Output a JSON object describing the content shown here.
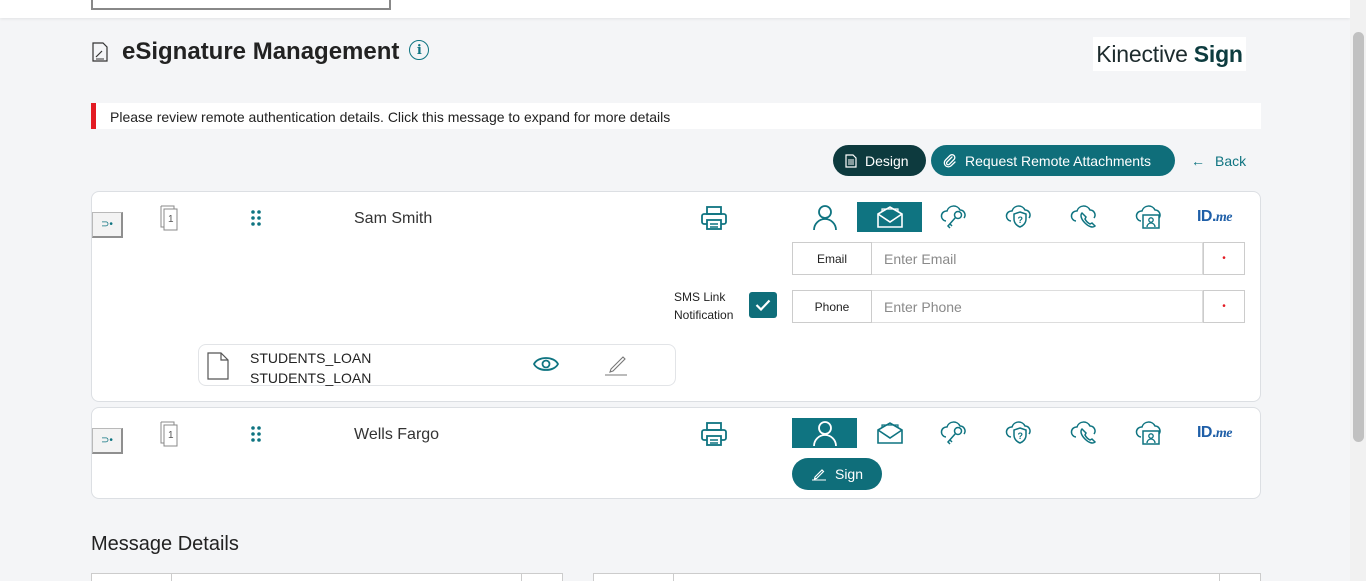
{
  "header": {
    "title": "eSignature Management",
    "brand_prefix": "Kinective",
    "brand_suffix": "Sign"
  },
  "alert": {
    "message": "Please review remote authentication details. Click this message to expand for more details"
  },
  "actions": {
    "design_label": "Design",
    "remote_label": "Request Remote Attachments",
    "back_label": "Back"
  },
  "signers": [
    {
      "name": "Sam Smith",
      "page_count": "1",
      "email_label": "Email",
      "email_placeholder": "Enter Email",
      "phone_label": "Phone",
      "phone_placeholder": "Enter Phone",
      "sms_label_1": "SMS Link",
      "sms_label_2": "Notification",
      "sms_checked": true,
      "document_line_1": "STUDENTS_LOAN",
      "document_line_2": "STUDENTS_LOAN",
      "active_auth": "email"
    },
    {
      "name": "Wells Fargo",
      "page_count": "1",
      "sign_label": "Sign",
      "active_auth": "in-person"
    }
  ],
  "idme": {
    "id": "ID.",
    "me": "me"
  },
  "section": {
    "message_details": "Message Details"
  },
  "colors": {
    "teal": "#0f7481",
    "dark_teal": "#0d3a3e",
    "alert_red": "#e31b23"
  }
}
